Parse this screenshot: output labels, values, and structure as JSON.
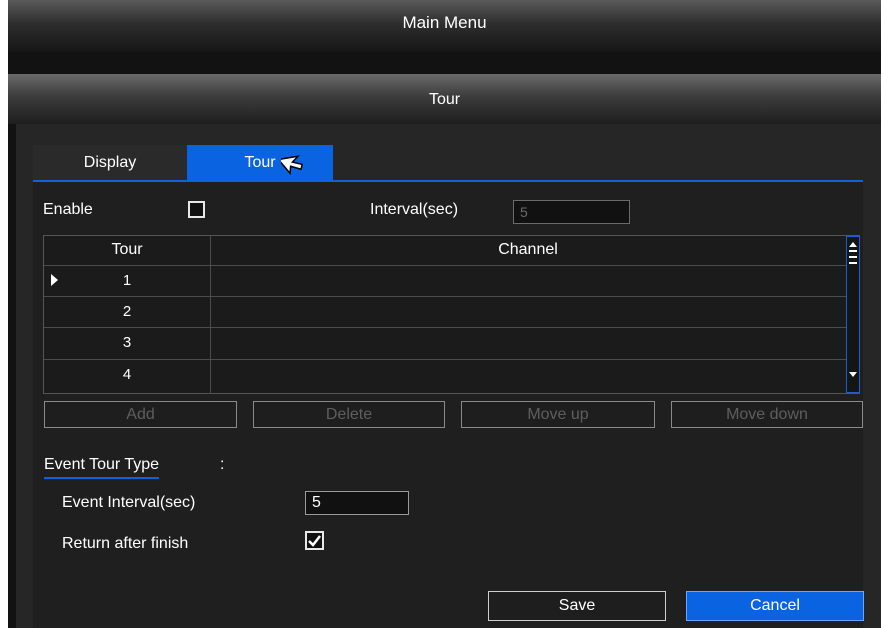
{
  "main_menu": {
    "title": "Main Menu"
  },
  "dialog": {
    "title": "Tour"
  },
  "tabs": [
    {
      "label": "Display",
      "active": false
    },
    {
      "label": "Tour",
      "active": true
    }
  ],
  "settings": {
    "enable_label": "Enable",
    "enable_checked": false,
    "interval_label": "Interval(sec)",
    "interval_value": "5"
  },
  "table": {
    "columns": [
      "Tour",
      "Channel"
    ],
    "rows": [
      {
        "tour": "1",
        "channel": "",
        "selected": true
      },
      {
        "tour": "2",
        "channel": ""
      },
      {
        "tour": "3",
        "channel": ""
      },
      {
        "tour": "4",
        "channel": ""
      }
    ]
  },
  "buttons": {
    "add": "Add",
    "delete": "Delete",
    "move_up": "Move up",
    "move_down": "Move down"
  },
  "event": {
    "heading": "Event Tour Type",
    "heading_suffix": ":",
    "interval_label": "Event Interval(sec)",
    "interval_value": "5",
    "return_label": "Return after finish",
    "return_checked": true
  },
  "footer": {
    "save": "Save",
    "cancel": "Cancel"
  },
  "colors": {
    "accent": "#0a63e0",
    "background": "#1f1f1f"
  }
}
